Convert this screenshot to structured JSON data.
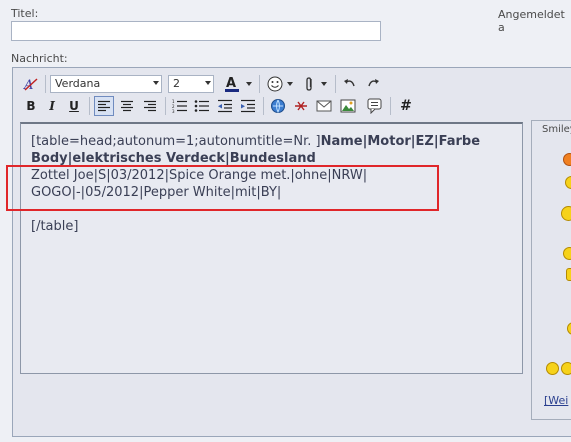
{
  "form": {
    "title_label": "Titel:",
    "title_value": "",
    "logged_in_label": "Angemeldet a",
    "message_label": "Nachricht:"
  },
  "toolbar": {
    "font_family": "Verdana",
    "font_size": "2",
    "bold": "B",
    "italic": "I",
    "underline": "U",
    "table_button": "#"
  },
  "editor": {
    "line1_pre": "[table=head;autonum=1;autonumtitle=Nr. ]",
    "line1_bold": "Name|Motor|EZ|Farbe",
    "line2_bold": "Body|elektrisches Verdeck|Bundesland",
    "line3": "Zottel Joe|S|03/2012|Spice Orange met.|ohne|NRW|",
    "line4": "GOGO|-|05/2012|Pepper White|mit|BY|",
    "line5": "[/table]"
  },
  "smilies": {
    "title": "Smiley",
    "more_link": "[Wei"
  },
  "colors": {
    "highlight_border": "#e0262a",
    "spellcheck_underline": "#e02020"
  }
}
